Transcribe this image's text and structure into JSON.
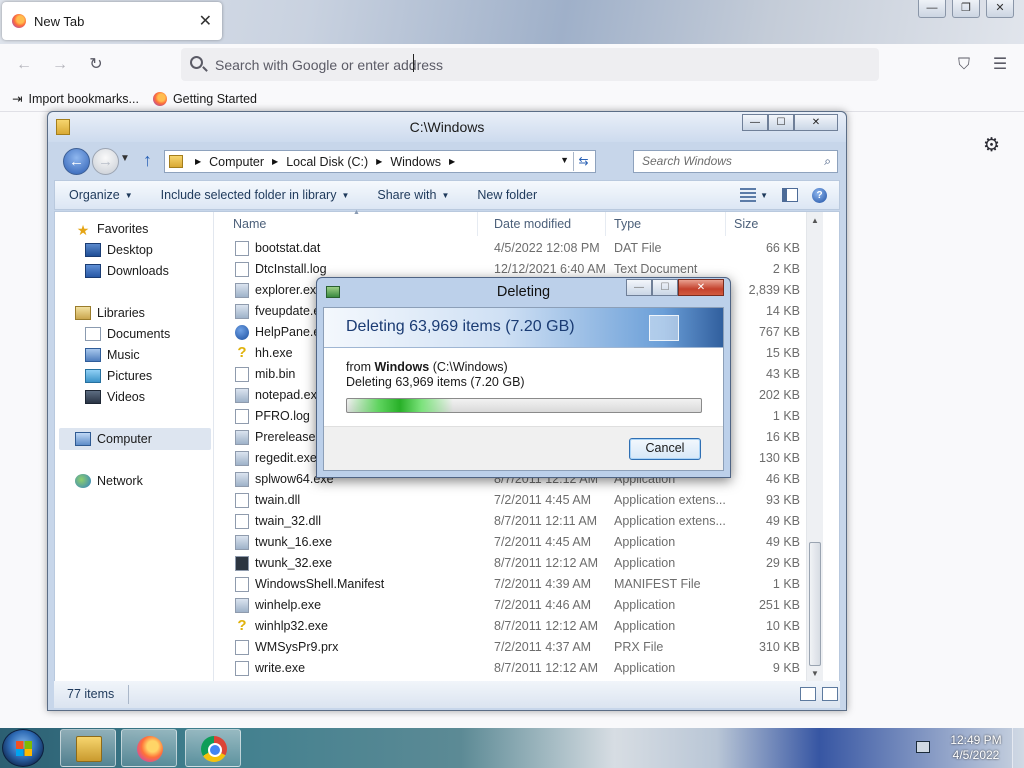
{
  "browser": {
    "tab_title": "New Tab",
    "tab_close": "✕",
    "url_placeholder": "Search with Google or enter address",
    "bookmarks": [
      {
        "label": "Import bookmarks..."
      },
      {
        "label": "Getting Started"
      }
    ],
    "window_controls": {
      "minimize": "—",
      "restore": "❐",
      "close": "✕"
    },
    "nav_icons": {
      "back": "←",
      "forward": "→",
      "reload": "↻",
      "pocket": "⛉",
      "menu": "☰",
      "settings": "⚙"
    }
  },
  "explorer": {
    "title": "C:\\Windows",
    "window_controls": {
      "minimize": "—",
      "maximize": "☐",
      "close": "✕"
    },
    "breadcrumb": [
      "Computer",
      "Local Disk (C:)",
      "Windows"
    ],
    "search_placeholder": "Search Windows",
    "toolbar": {
      "organize": "Organize",
      "include": "Include selected folder in library",
      "share": "Share with",
      "new_folder": "New folder"
    },
    "nav": {
      "favorites": "Favorites",
      "desktop": "Desktop",
      "downloads": "Downloads",
      "libraries": "Libraries",
      "documents": "Documents",
      "music": "Music",
      "pictures": "Pictures",
      "videos": "Videos",
      "computer": "Computer",
      "network": "Network"
    },
    "columns": {
      "name": "Name",
      "date": "Date modified",
      "type": "Type",
      "size": "Size"
    },
    "files": [
      {
        "name": "bootstat.dat",
        "date": "4/5/2022 12:08 PM",
        "type": "DAT File",
        "size": "66 KB",
        "icon": "file"
      },
      {
        "name": "DtcInstall.log",
        "date": "12/12/2021 6:40 AM",
        "type": "Text Document",
        "size": "2 KB",
        "icon": "file"
      },
      {
        "name": "explorer.exe",
        "date": "",
        "type": "",
        "size": "2,839 KB",
        "icon": "exe"
      },
      {
        "name": "fveupdate.e",
        "date": "",
        "type": "",
        "size": "14 KB",
        "icon": "exe"
      },
      {
        "name": "HelpPane.ex",
        "date": "",
        "type": "",
        "size": "767 KB",
        "icon": "q"
      },
      {
        "name": "hh.exe",
        "date": "",
        "type": "",
        "size": "15 KB",
        "icon": "help"
      },
      {
        "name": "mib.bin",
        "date": "",
        "type": "",
        "size": "43 KB",
        "icon": "file"
      },
      {
        "name": "notepad.exe",
        "date": "",
        "type": "",
        "size": "202 KB",
        "icon": "exe"
      },
      {
        "name": "PFRO.log",
        "date": "",
        "type": "",
        "size": "1 KB",
        "icon": "file"
      },
      {
        "name": "Prerelease.x",
        "date": "",
        "type": "",
        "size": "16 KB",
        "icon": "exe"
      },
      {
        "name": "regedit.exe",
        "date": "",
        "type": "",
        "size": "130 KB",
        "icon": "exe"
      },
      {
        "name": "splwow64.exe",
        "date": "8/7/2011 12:12 AM",
        "type": "Application",
        "size": "46 KB",
        "icon": "exe"
      },
      {
        "name": "twain.dll",
        "date": "7/2/2011 4:45 AM",
        "type": "Application extens...",
        "size": "93 KB",
        "icon": "file"
      },
      {
        "name": "twain_32.dll",
        "date": "8/7/2011 12:11 AM",
        "type": "Application extens...",
        "size": "49 KB",
        "icon": "file"
      },
      {
        "name": "twunk_16.exe",
        "date": "7/2/2011 4:45 AM",
        "type": "Application",
        "size": "49 KB",
        "icon": "exe"
      },
      {
        "name": "twunk_32.exe",
        "date": "8/7/2011 12:12 AM",
        "type": "Application",
        "size": "29 KB",
        "icon": "film"
      },
      {
        "name": "WindowsShell.Manifest",
        "date": "7/2/2011 4:39 AM",
        "type": "MANIFEST File",
        "size": "1 KB",
        "icon": "file"
      },
      {
        "name": "winhelp.exe",
        "date": "7/2/2011 4:46 AM",
        "type": "Application",
        "size": "251 KB",
        "icon": "exe"
      },
      {
        "name": "winhlp32.exe",
        "date": "8/7/2011 12:12 AM",
        "type": "Application",
        "size": "10 KB",
        "icon": "help"
      },
      {
        "name": "WMSysPr9.prx",
        "date": "7/2/2011 4:37 AM",
        "type": "PRX File",
        "size": "310 KB",
        "icon": "file"
      },
      {
        "name": "write.exe",
        "date": "8/7/2011 12:12 AM",
        "type": "Application",
        "size": "9 KB",
        "icon": "file"
      }
    ],
    "status": "77 items"
  },
  "dialog": {
    "title": "Deleting",
    "heading": "Deleting 63,969 items (7.20 GB)",
    "from_label": "from",
    "from_folder": "Windows",
    "from_path": "(C:\\Windows)",
    "detail": "Deleting 63,969 items (7.20 GB)",
    "progress_fraction": 0.3,
    "cancel": "Cancel"
  },
  "taskbar": {
    "time": "12:49 PM",
    "date": "4/5/2022"
  }
}
